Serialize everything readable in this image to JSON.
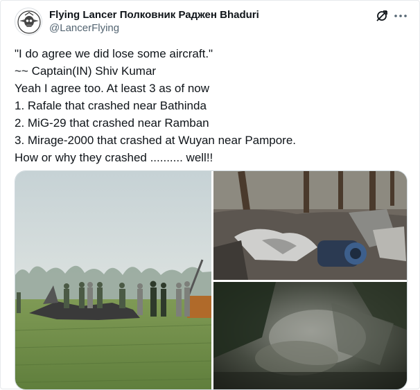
{
  "post": {
    "display_name": "Flying Lancer Полковник Раджен Bhaduri",
    "handle": "@LancerFlying",
    "lines": [
      "\"I do agree we did lose some aircraft.\"",
      "~~ Captain(IN) Shiv Kumar",
      "Yeah I agree too. At least 3 as of now",
      "1. Rafale that crashed near Bathinda",
      "2. MiG-29 that crashed near Ramban",
      "3. Mirage-2000 that crashed at Wuyan near Pampore.",
      "How or why they crashed .......... well!!"
    ]
  },
  "icons": {
    "grok": "grok-icon",
    "more": "more-icon"
  },
  "colors": {
    "text": "#0f1419",
    "secondary": "#536471",
    "border": "#cfd9de"
  }
}
